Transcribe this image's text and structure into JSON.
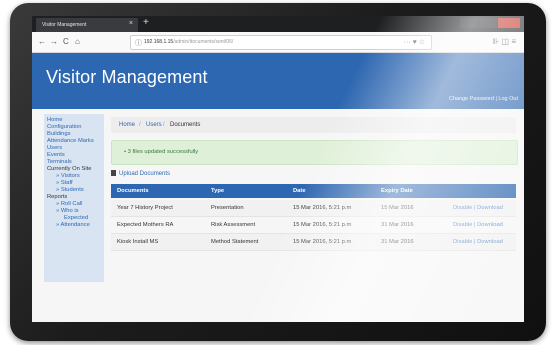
{
  "browser": {
    "tab_title": "Visitor Management",
    "tab_close": "×",
    "new_tab": "+",
    "url_host": "192.168.1.15",
    "url_path": "/admin/documents/sent/06/",
    "page_actions": "··· ♥ ☆",
    "toolbar_right": "⊪ ◫ ≡",
    "nav": {
      "back": "←",
      "forward": "→",
      "reload": "C",
      "home": "⌂"
    },
    "colors": {
      "min": "#2b2c2f",
      "max": "#2b2c2f",
      "close": "#c42b1c"
    }
  },
  "app": {
    "title": "Visitor Management",
    "header_links": {
      "change_password": "Change Password",
      "separator": "|",
      "logout": "Log Out"
    },
    "accent": "#2e67b1"
  },
  "sidebar": {
    "items": [
      {
        "label": "Home",
        "type": "link"
      },
      {
        "label": "Configuration",
        "type": "link"
      },
      {
        "label": "Buildings",
        "type": "link"
      },
      {
        "label": "Attendance Marks",
        "type": "link"
      },
      {
        "label": "Users",
        "type": "link"
      },
      {
        "label": "Events",
        "type": "link"
      },
      {
        "label": "Terminals",
        "type": "link"
      },
      {
        "label": "Currently On Site",
        "type": "heading"
      },
      {
        "label": "» Visitors",
        "type": "sub"
      },
      {
        "label": "» Staff",
        "type": "sub"
      },
      {
        "label": "» Students",
        "type": "sub"
      },
      {
        "label": "Reports",
        "type": "heading"
      },
      {
        "label": "» Roll Call",
        "type": "sub"
      },
      {
        "label": "» Who is",
        "type": "sub"
      },
      {
        "label": "Expected",
        "type": "sub2"
      },
      {
        "label": "» Attendance",
        "type": "sub"
      }
    ]
  },
  "breadcrumb": {
    "home": "Home",
    "sep": "/",
    "users": "Users",
    "current": "Documents"
  },
  "alert": {
    "message": "• 3 files updated successfully"
  },
  "upload_link": "Upload Documents",
  "table": {
    "headers": [
      "Documents",
      "Type",
      "Date",
      "Expiry Date",
      ""
    ],
    "rows": [
      {
        "document": "Year 7 History Project",
        "type": "Presentation",
        "date": "15 Mar 2016, 5:21 p.m",
        "expiry": "15 Mar 2016",
        "disable": "Disable",
        "sep": "|",
        "download": "Download"
      },
      {
        "document": "Expected Mothers RA",
        "type": "Risk Assessment",
        "date": "15 Mar 2016, 5:21 p.m",
        "expiry": "31 Mar 2016",
        "disable": "Disable",
        "sep": "|",
        "download": "Download"
      },
      {
        "document": "Kiosk Install MS",
        "type": "Method Statement",
        "date": "15 Mar 2016, 5:21 p.m",
        "expiry": "31 Mar 2016",
        "disable": "Disable",
        "sep": "|",
        "download": "Download"
      }
    ]
  }
}
